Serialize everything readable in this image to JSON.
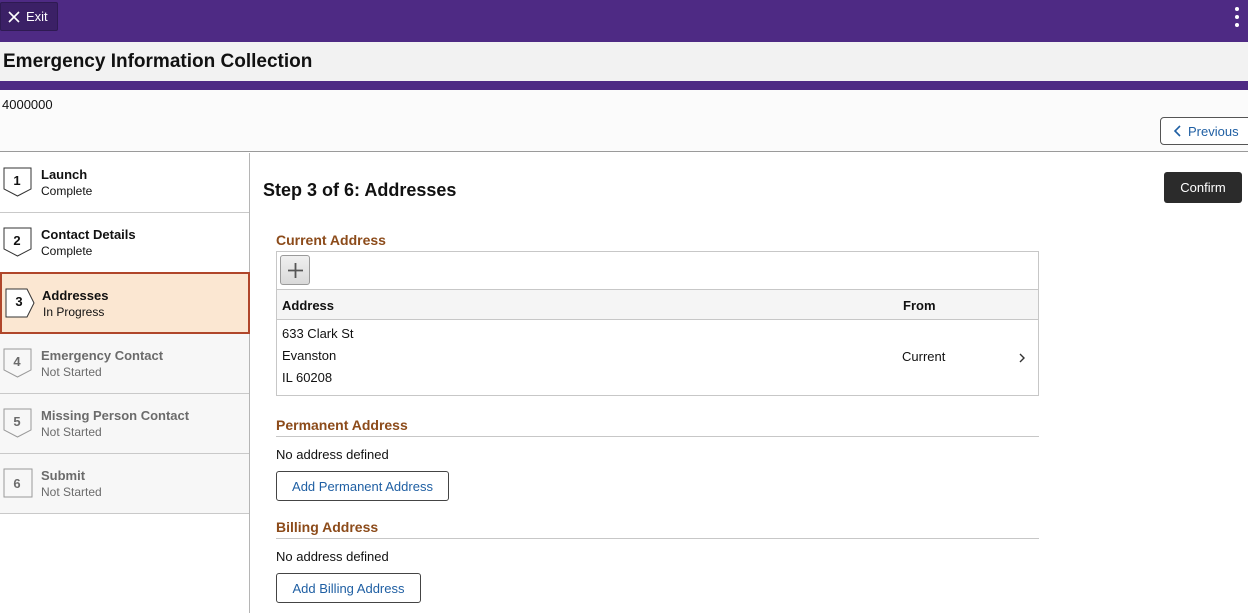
{
  "topbar": {
    "exit_label": "Exit",
    "brand_color": "#4e2a84"
  },
  "header": {
    "title": "Emergency Information Collection",
    "student_id": "4000000",
    "previous_label": "Previous"
  },
  "sidebar": {
    "steps": [
      {
        "number": "1",
        "name": "Launch",
        "status": "Complete"
      },
      {
        "number": "2",
        "name": "Contact Details",
        "status": "Complete"
      },
      {
        "number": "3",
        "name": "Addresses",
        "status": "In Progress"
      },
      {
        "number": "4",
        "name": "Emergency Contact",
        "status": "Not Started"
      },
      {
        "number": "5",
        "name": "Missing Person Contact",
        "status": "Not Started"
      },
      {
        "number": "6",
        "name": "Submit",
        "status": "Not Started"
      }
    ]
  },
  "main": {
    "step_heading": "Step 3 of 6: Addresses",
    "confirm_label": "Confirm",
    "current_address": {
      "title": "Current Address",
      "columns": {
        "address": "Address",
        "from": "From"
      },
      "rows": [
        {
          "line1": "633 Clark St",
          "line2": "Evanston",
          "line3": "IL 60208",
          "from": "Current"
        }
      ]
    },
    "permanent_address": {
      "title": "Permanent Address",
      "empty_text": "No address defined",
      "add_label": "Add Permanent Address"
    },
    "billing_address": {
      "title": "Billing Address",
      "empty_text": "No address defined",
      "add_label": "Add Billing Address"
    }
  },
  "icons": {
    "exit": "close-icon",
    "menu": "kebab-menu-icon",
    "previous": "chevron-left-icon",
    "add_row": "plus-icon",
    "row_detail": "chevron-right-icon"
  },
  "colors": {
    "accent_heading": "#8c4b1a",
    "active_step_bg": "#fbe7d2",
    "active_step_border": "#b0462a",
    "link": "#1f5fa3",
    "primary_button": "#2b2b2b"
  }
}
